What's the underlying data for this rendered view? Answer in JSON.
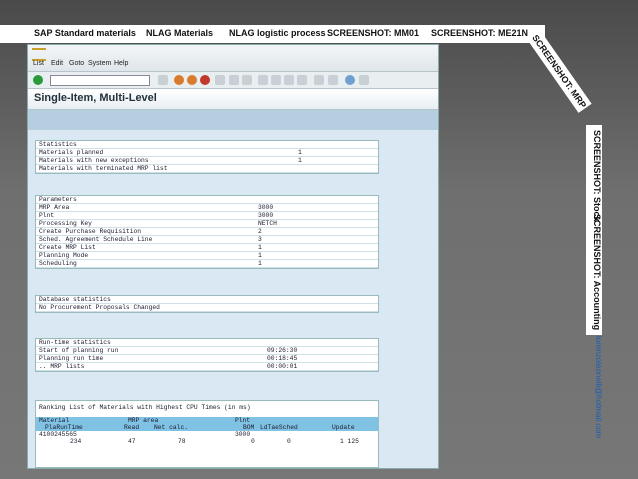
{
  "tabs": [
    "SAP Standard materials",
    "NLAG Materials",
    "NLAG logistic process",
    "SCREENSHOT: MM01",
    "SCREENSHOT: ME21N"
  ],
  "diag_tab": "SCREENSHOT: MRP",
  "vertical_tabs": [
    "SCREENSHOT: Stock",
    "SCREENSHOT: Accounting"
  ],
  "email": "lorenzoleonelli@hotmail.com",
  "sap": {
    "menu": [
      "List",
      "Edit",
      "Goto",
      "System",
      "Help"
    ],
    "title": "Single-Item, Multi-Level",
    "statistics": {
      "header": "Statistics",
      "rows": [
        {
          "label": "Materials planned",
          "value": "1"
        },
        {
          "label": "Materials with new exceptions",
          "value": "1"
        },
        {
          "label": "Materials with terminated MRP list",
          "value": ""
        }
      ]
    },
    "parameters": {
      "header": "Parameters",
      "rows": [
        {
          "label": "MRP Area",
          "value": "3000"
        },
        {
          "label": "Plnt",
          "value": "3000"
        },
        {
          "label": "Processing Key",
          "value": "NETCH"
        },
        {
          "label": "Create Purchase Requisition",
          "value": "2"
        },
        {
          "label": "Sched. Agreement Schedule Line",
          "value": "3"
        },
        {
          "label": "Create MRP List",
          "value": "1"
        },
        {
          "label": "Planning Mode",
          "value": "1"
        },
        {
          "label": "Scheduling",
          "value": "1"
        }
      ]
    },
    "database": {
      "header": "Database statistics",
      "rows": [
        {
          "label": "No Procurement Proposals Changed",
          "value": ""
        }
      ]
    },
    "runtime": {
      "header": "Run-time statistics",
      "rows": [
        {
          "label": "Start of planning run",
          "value": "09:26:30"
        },
        {
          "label": "Planning run time",
          "value": "00:18:45"
        },
        {
          "label": ".. MRP lists",
          "value": "00:00:01"
        }
      ]
    },
    "ranking": {
      "header": "Ranking List of Materials with Highest CPU Times (in ms)",
      "col_row1": [
        "Material",
        "MRP area",
        "Plnt"
      ],
      "col_row2": [
        "PlaRunTime",
        "Read",
        "Net calc.",
        "BOM",
        "LdTaeSched",
        "Update"
      ],
      "data_row1": [
        "4100245565",
        "",
        "3000"
      ],
      "data_row2": [
        "234",
        "47",
        "78",
        "0",
        "0",
        "1 125"
      ]
    }
  }
}
